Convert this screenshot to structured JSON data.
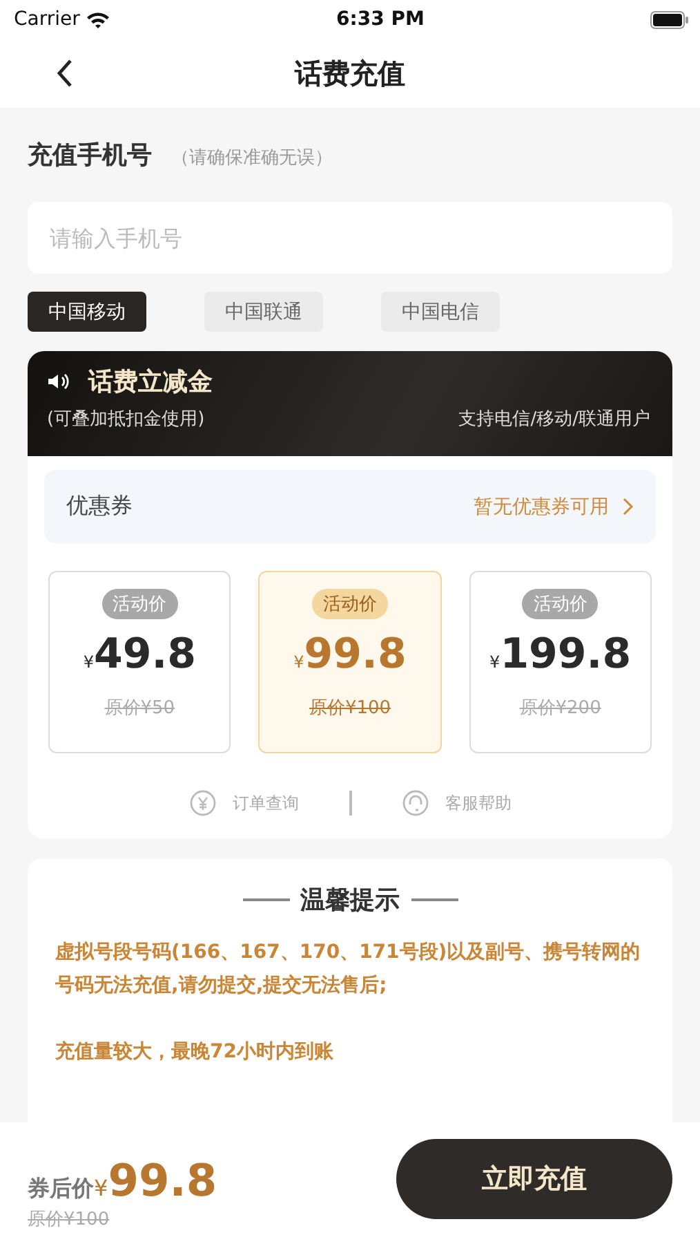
{
  "status_bar": {
    "carrier": "Carrier",
    "time": "6:33 PM"
  },
  "nav": {
    "title": "话费充值"
  },
  "phone_section": {
    "title": "充值手机号",
    "hint": "（请确保准确无误）",
    "placeholder": "请输入手机号"
  },
  "operators": [
    {
      "label": "中国移动",
      "selected": true
    },
    {
      "label": "中国联通",
      "selected": false
    },
    {
      "label": "中国电信",
      "selected": false
    }
  ],
  "banner": {
    "title": "话费立减金",
    "subtitle": "(可叠加抵扣金使用)",
    "support": "支持电信/移动/联通用户"
  },
  "coupon": {
    "label": "优惠券",
    "value": "暂无优惠券可用"
  },
  "prices": [
    {
      "tag": "活动价",
      "currency": "¥",
      "price": "49.8",
      "original": "原价¥50",
      "selected": false
    },
    {
      "tag": "活动价",
      "currency": "¥",
      "price": "99.8",
      "original": "原价¥100",
      "selected": true
    },
    {
      "tag": "活动价",
      "currency": "¥",
      "price": "199.8",
      "original": "原价¥200",
      "selected": false
    }
  ],
  "links": [
    {
      "kind": "order",
      "label": "订单查询"
    },
    {
      "kind": "service",
      "label": "客服帮助"
    }
  ],
  "tips": {
    "title": "温馨提示",
    "items": [
      "虚拟号段号码(166、167、170、171号段)以及副号、携号转网的号码无法充值,请勿提交,提交无法售后;",
      "充值量较大，最晚72小时内到账"
    ]
  },
  "footer": {
    "label": "券后价",
    "currency": "¥",
    "price": "99.8",
    "original": "原价¥100",
    "button": "立即充值"
  }
}
